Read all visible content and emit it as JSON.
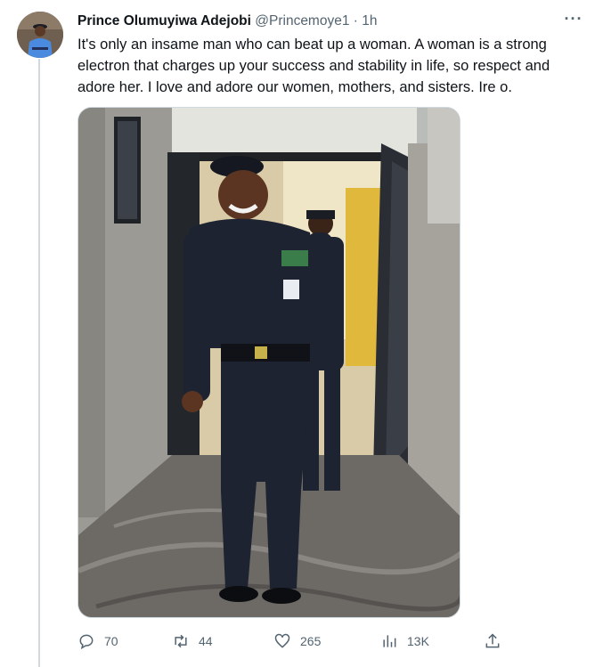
{
  "tweet": {
    "author_name": "Prince Olumuyiwa Adejobi",
    "handle": "@Princemoye1",
    "separator": "·",
    "time": "1h",
    "more_label": "···",
    "text": "It's only an insame man who can beat up a woman. A woman is a strong electron that charges up your success and stability in life, so respect and adore her. I love and adore our women, mothers, and sisters. Ire o.",
    "media_icon": "photo-of-police-officer-in-uniform-walking-through-doorway"
  },
  "actions": {
    "replies": "70",
    "retweets": "44",
    "likes": "265",
    "views": "13K"
  },
  "colors": {
    "secondary_text": "#536471",
    "divider": "#cfd9de",
    "uniform": "#1d2330"
  }
}
